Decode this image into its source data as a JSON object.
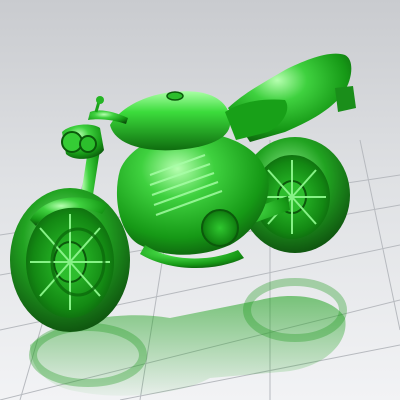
{
  "viewport": {
    "model": "motorcycle",
    "shading": "solid",
    "view": "perspective",
    "colors": {
      "model": "#1fa81f",
      "model_highlight": "#9ef59e",
      "model_dark": "#0b4d0b",
      "background_top": "#c9cbcf",
      "background_bottom": "#f2f3f5",
      "grid": "#b7babf"
    },
    "grid": true,
    "ground_reflection": true
  }
}
